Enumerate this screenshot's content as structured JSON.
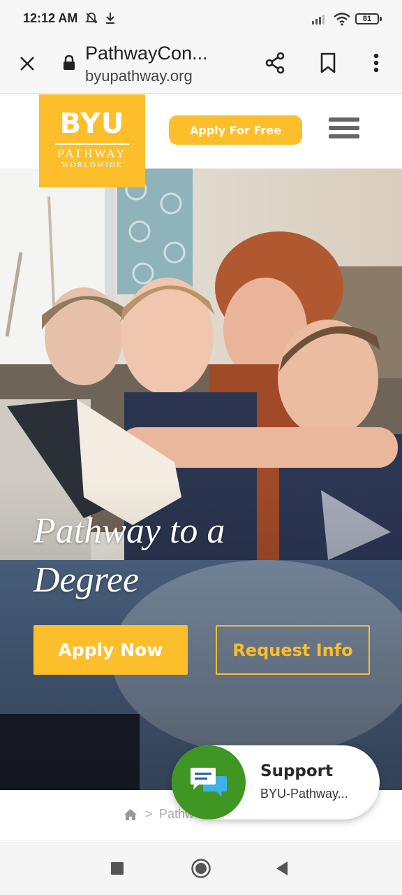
{
  "status_bar": {
    "time": "12:12 AM",
    "battery": "81",
    "icons": [
      "mute-bell-icon",
      "download-icon",
      "signal-icon",
      "wifi-icon",
      "battery-icon"
    ]
  },
  "browser": {
    "title": "PathwayCon...",
    "domain": "byupathway.org",
    "icons": [
      "close-icon",
      "lock-icon",
      "share-icon",
      "bookmark-icon",
      "more-vert-icon"
    ]
  },
  "header": {
    "logo_byu": "BYU",
    "logo_pathway": "PATHWAY",
    "logo_worldwide": "WORLDWIDE",
    "apply_free_label": "Apply For Free",
    "menu_icon": "hamburger-icon"
  },
  "hero": {
    "title": "Pathway to a Degree",
    "apply_now_label": "Apply Now",
    "request_info_label": "Request Info"
  },
  "breadcrumb": {
    "separator": ">",
    "current": "Pathw"
  },
  "support": {
    "title": "Support",
    "subtitle": "BYU-Pathway..."
  },
  "colors": {
    "brand_yellow": "#fdbe2c",
    "support_green": "#3f9623"
  },
  "nav": {
    "icons": [
      "recents-square-icon",
      "home-circle-icon",
      "back-triangle-icon"
    ]
  }
}
